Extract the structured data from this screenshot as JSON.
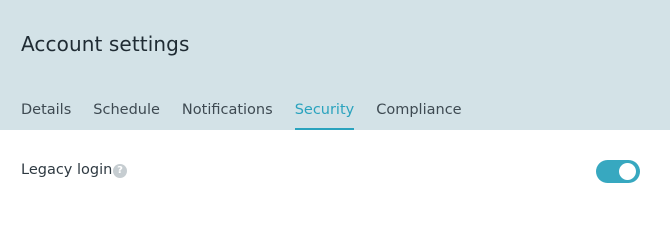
{
  "header": {
    "title": "Account settings"
  },
  "tabs": [
    {
      "label": "Details",
      "active": false
    },
    {
      "label": "Schedule",
      "active": false
    },
    {
      "label": "Notifications",
      "active": false
    },
    {
      "label": "Security",
      "active": true
    },
    {
      "label": "Compliance",
      "active": false
    }
  ],
  "settings": {
    "legacy_login": {
      "label": "Legacy login",
      "help_glyph": "?",
      "enabled": true
    }
  },
  "colors": {
    "header_bg": "#d3e2e7",
    "accent": "#2aa3be",
    "toggle_on": "#37a8c0"
  }
}
